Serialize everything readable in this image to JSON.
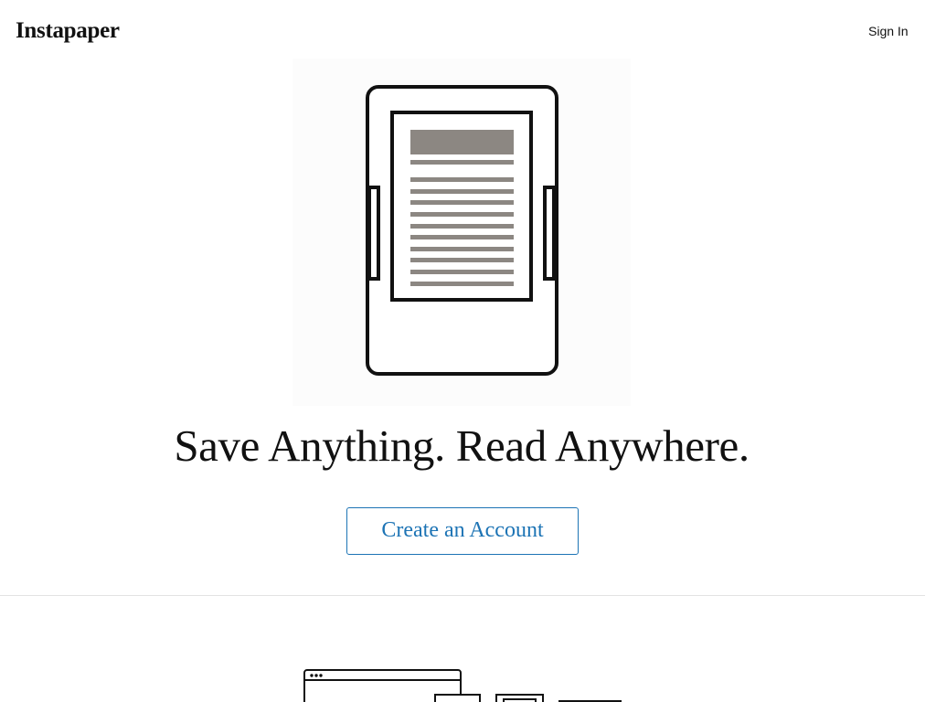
{
  "header": {
    "logo_text": "Instapaper",
    "sign_in_label": "Sign In"
  },
  "hero": {
    "illustration_icon": "e-reader-icon",
    "headline": "Save Anything. Read Anywhere.",
    "cta_label": "Create an Account"
  },
  "features_preview": {
    "illustration_icon": "devices-illustration-icon"
  },
  "colors": {
    "accent": "#1d74b5",
    "text": "#111111",
    "divider": "#e3e3e3",
    "article_bar": "#8c8782"
  }
}
